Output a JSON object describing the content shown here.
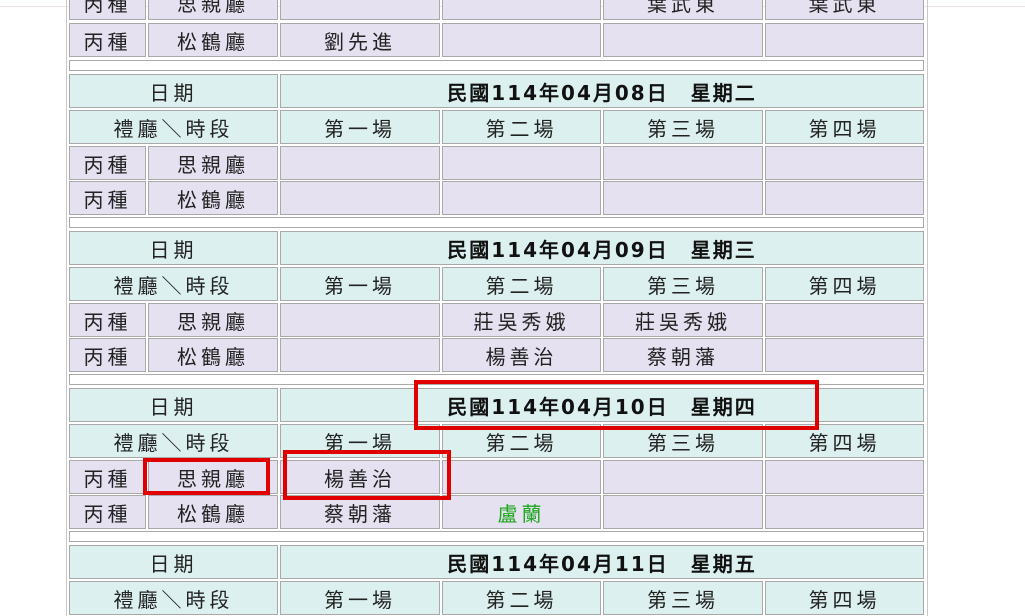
{
  "labels": {
    "date": "日期",
    "hall_slot": "禮廳＼時段",
    "slots": [
      "第一場",
      "第二場",
      "第三場",
      "第四場"
    ]
  },
  "partial_top": {
    "type": "丙種",
    "hall": "思親廳",
    "slot3": "葉武東",
    "slot4": "葉武東"
  },
  "block0": {
    "row2": {
      "type": "丙種",
      "hall": "松鶴廳",
      "slots": [
        "劉先進",
        "",
        "",
        ""
      ]
    }
  },
  "blocks": [
    {
      "date": "民國114年04月08日　星期二",
      "rows": [
        {
          "type": "丙種",
          "hall": "思親廳",
          "slots": [
            "",
            "",
            "",
            ""
          ]
        },
        {
          "type": "丙種",
          "hall": "松鶴廳",
          "slots": [
            "",
            "",
            "",
            ""
          ]
        }
      ]
    },
    {
      "date": "民國114年04月09日　星期三",
      "rows": [
        {
          "type": "丙種",
          "hall": "思親廳",
          "slots": [
            "",
            "莊吳秀娥",
            "莊吳秀娥",
            ""
          ]
        },
        {
          "type": "丙種",
          "hall": "松鶴廳",
          "slots": [
            "",
            "楊善治",
            "蔡朝藩",
            ""
          ]
        }
      ]
    },
    {
      "date": "民國114年04月10日　星期四",
      "rows": [
        {
          "type": "丙種",
          "hall": "思親廳",
          "slots": [
            "楊善治",
            "",
            "",
            ""
          ]
        },
        {
          "type": "丙種",
          "hall": "松鶴廳",
          "slots": [
            "蔡朝藩",
            "盧蘭",
            "",
            ""
          ]
        }
      ]
    },
    {
      "date": "民國114年04月11日　星期五"
    }
  ],
  "colors": {
    "header_bg": "#dcf0f0",
    "row_bg": "#e5e1f1",
    "highlight": "#e00000",
    "new_entry_text": "#1fa81f"
  }
}
